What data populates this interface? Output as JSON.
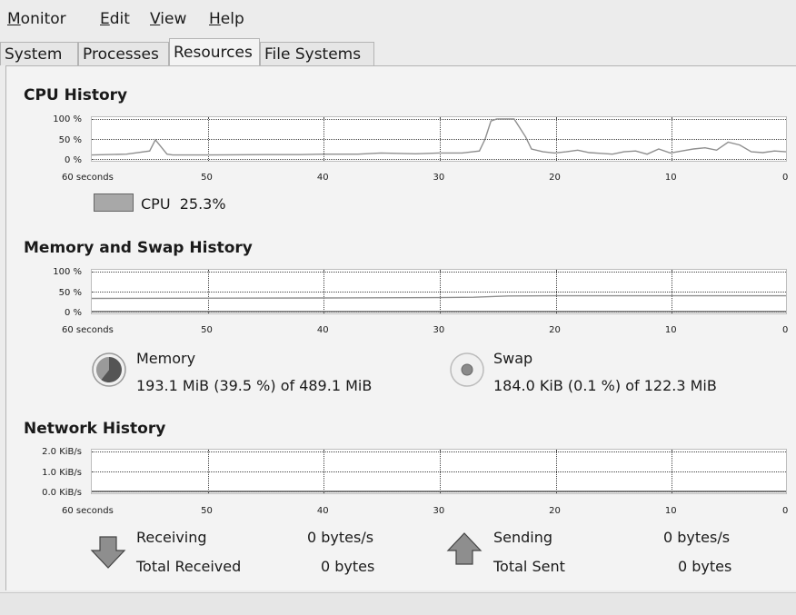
{
  "menu": {
    "monitor": {
      "u": "M",
      "rest": "onitor"
    },
    "edit": {
      "u": "E",
      "rest": "dit"
    },
    "view": {
      "u": "V",
      "rest": "iew"
    },
    "help": {
      "u": "H",
      "rest": "elp"
    }
  },
  "tabs": [
    "System",
    "Processes",
    "Resources",
    "File Systems"
  ],
  "active_tab": "Resources",
  "x_ticks": [
    "60 seconds",
    "50",
    "40",
    "30",
    "20",
    "10",
    "0"
  ],
  "cpu": {
    "title": "CPU History",
    "y_ticks": [
      "100 %",
      "50 %",
      "0 %"
    ],
    "legend_label": "CPU",
    "legend_value": "25.3%",
    "swatch_color": "#a8a8a8"
  },
  "memory": {
    "title": "Memory and Swap History",
    "y_ticks": [
      "100 %",
      "50 %",
      "0 %"
    ],
    "memory_label": "Memory",
    "memory_value": "193.1 MiB (39.5 %) of 489.1 MiB",
    "swap_label": "Swap",
    "swap_value": "184.0 KiB (0.1 %) of 122.3 MiB"
  },
  "network": {
    "title": "Network History",
    "y_ticks": [
      "2.0 KiB/s",
      "1.0 KiB/s",
      "0.0 KiB/s"
    ],
    "receiving_label": "Receiving",
    "receiving_value": "0 bytes/s",
    "total_received_label": "Total Received",
    "total_received_value": "0 bytes",
    "sending_label": "Sending",
    "sending_value": "0 bytes/s",
    "total_sent_label": "Total Sent",
    "total_sent_value": "0 bytes"
  },
  "chart_data": [
    {
      "type": "line",
      "title": "CPU History",
      "xlabel": "seconds",
      "ylabel": "",
      "xlim": [
        60,
        0
      ],
      "ylim": [
        0,
        100
      ],
      "x": [
        60,
        57,
        55,
        54.5,
        54,
        53.5,
        53,
        50,
        45,
        42,
        40,
        37,
        35,
        32,
        30,
        28,
        26.5,
        26,
        25.5,
        25,
        23.5,
        22.5,
        22,
        21,
        20,
        19,
        18,
        17,
        16,
        15,
        14,
        13,
        12,
        11,
        10,
        9,
        8,
        7,
        6,
        5,
        4,
        3,
        2,
        1,
        0
      ],
      "series": [
        {
          "name": "CPU",
          "values": [
            10,
            12,
            20,
            48,
            30,
            12,
            10,
            10,
            11,
            11,
            12,
            12,
            15,
            13,
            15,
            15,
            20,
            50,
            95,
            100,
            100,
            55,
            25,
            18,
            15,
            18,
            22,
            16,
            14,
            12,
            18,
            20,
            12,
            25,
            15,
            20,
            25,
            28,
            22,
            42,
            35,
            18,
            16,
            20,
            18
          ]
        }
      ]
    },
    {
      "type": "line",
      "title": "Memory and Swap History",
      "xlabel": "seconds",
      "ylabel": "",
      "xlim": [
        60,
        0
      ],
      "ylim": [
        0,
        100
      ],
      "x": [
        60,
        40,
        30,
        27,
        24,
        20,
        10,
        0
      ],
      "series": [
        {
          "name": "Memory",
          "values": [
            33,
            34,
            35,
            36,
            39,
            39.5,
            39.5,
            39.5
          ]
        },
        {
          "name": "Swap",
          "values": [
            0.1,
            0.1,
            0.1,
            0.1,
            0.1,
            0.1,
            0.1,
            0.1
          ]
        }
      ]
    },
    {
      "type": "line",
      "title": "Network History",
      "xlabel": "seconds",
      "ylabel": "",
      "xlim": [
        60,
        0
      ],
      "ylim": [
        0,
        2
      ],
      "x": [
        60,
        0
      ],
      "series": [
        {
          "name": "Receiving",
          "values": [
            0,
            0
          ]
        },
        {
          "name": "Sending",
          "values": [
            0,
            0
          ]
        }
      ]
    }
  ]
}
